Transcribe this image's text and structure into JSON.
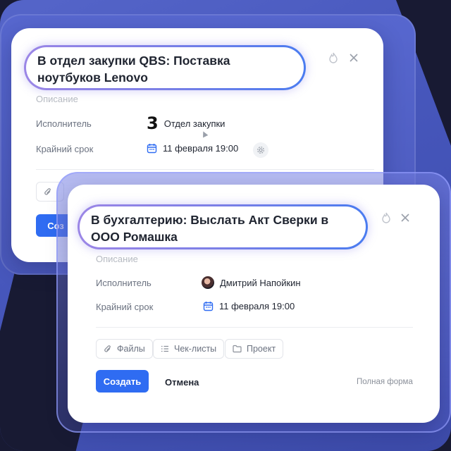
{
  "colors": {
    "accent": "#2f6cf2",
    "background_blue": "#4a58ba",
    "dark": "#181a33"
  },
  "card1": {
    "title": "В отдел закупки QBS:  Поставка ноутбуков Lenovo",
    "description_placeholder": "Описание",
    "assignee_label": "Исполнитель",
    "assignee_badge": "3",
    "assignee_value": "Отдел закупки",
    "deadline_label": "Крайний срок",
    "deadline_value": "11 февраля 19:00",
    "create_button_partial": "Соз",
    "icons": [
      "fire-icon",
      "close-icon",
      "calendar-icon",
      "gear-icon",
      "paperclip-icon"
    ]
  },
  "card2": {
    "title": "В бухгалтерию: Выслать Акт Сверки в ООО Ромашка",
    "description_placeholder": "Описание",
    "assignee_label": "Исполнитель",
    "assignee_value": "Дмитрий Напойкин",
    "deadline_label": "Крайний срок",
    "deadline_value": "11 февраля 19:00",
    "chips": {
      "files": "Файлы",
      "checklists": "Чек-листы",
      "project": "Проект"
    },
    "create_button": "Создать",
    "cancel_button": "Отмена",
    "full_form_link": "Полная форма",
    "icons": [
      "fire-icon",
      "close-icon",
      "avatar",
      "calendar-icon",
      "paperclip-icon",
      "checklist-icon",
      "folder-icon"
    ]
  }
}
